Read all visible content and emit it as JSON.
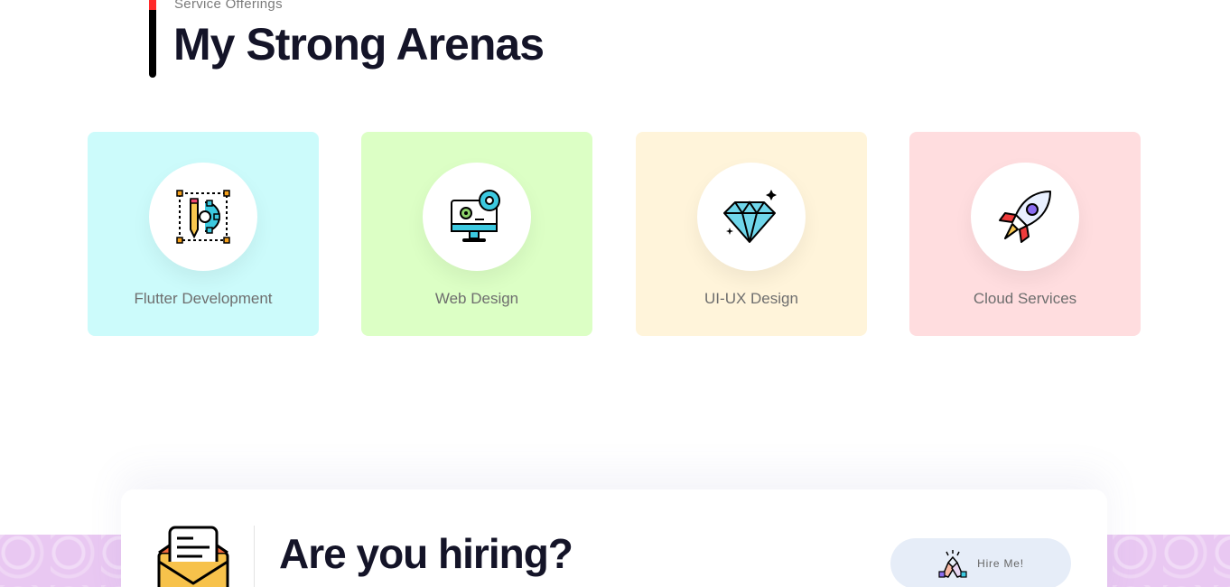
{
  "section": {
    "subtitle": "Service Offerings",
    "title": "My Strong Arenas"
  },
  "services": [
    {
      "label": "Flutter Development",
      "icon": "design-tool-icon",
      "bg": "#ccfbfb"
    },
    {
      "label": "Web Design",
      "icon": "monitor-gear-icon",
      "bg": "#dcffc5"
    },
    {
      "label": "UI-UX Design",
      "icon": "diamond-icon",
      "bg": "#fff4da"
    },
    {
      "label": "Cloud Services",
      "icon": "rocket-icon",
      "bg": "#ffdddf"
    }
  ],
  "hiring": {
    "title": "Are you hiring?",
    "button_label": "Hire Me!",
    "icon": "envelope-icon",
    "button_icon": "handshake-icon"
  },
  "colors": {
    "accent_red": "#ff2a2a",
    "heading": "#141428",
    "wave_bg": "#e9c8f2"
  }
}
